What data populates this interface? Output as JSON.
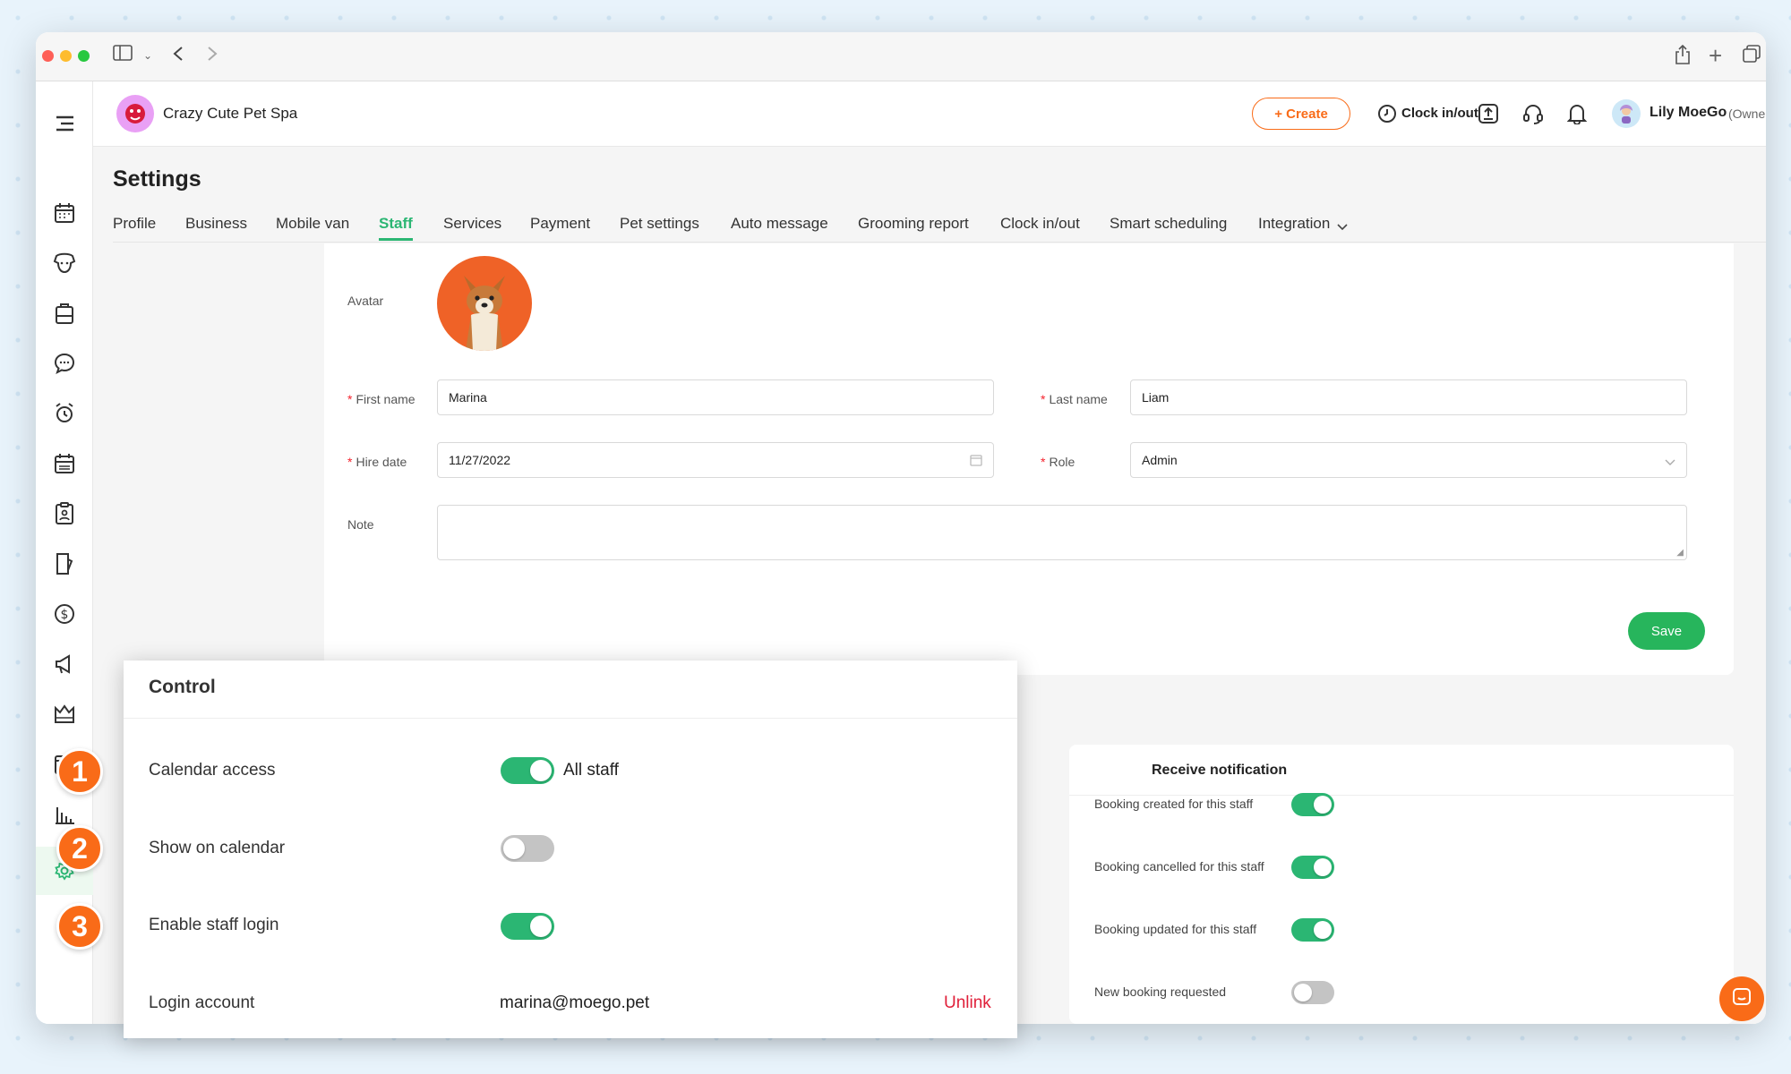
{
  "app": {
    "business_name": "Crazy Cute Pet Spa",
    "create_label": "+ Create",
    "clock_label": "Clock in/out",
    "user_name": "Lily MoeGo",
    "user_role": "(Owner)"
  },
  "page": {
    "title": "Settings"
  },
  "tabs": [
    {
      "label": "Profile"
    },
    {
      "label": "Business"
    },
    {
      "label": "Mobile van"
    },
    {
      "label": "Staff",
      "active": true
    },
    {
      "label": "Services"
    },
    {
      "label": "Payment"
    },
    {
      "label": "Pet settings"
    },
    {
      "label": "Auto message"
    },
    {
      "label": "Grooming report"
    },
    {
      "label": "Clock in/out"
    },
    {
      "label": "Smart scheduling"
    },
    {
      "label": "Integration"
    }
  ],
  "form": {
    "avatar_label": "Avatar",
    "first_name_label": "First name",
    "first_name_value": "Marina",
    "last_name_label": "Last name",
    "last_name_value": "Liam",
    "hire_date_label": "Hire date",
    "hire_date_value": "11/27/2022",
    "role_label": "Role",
    "role_value": "Admin",
    "note_label": "Note",
    "note_value": "",
    "save_label": "Save"
  },
  "control": {
    "title": "Control",
    "items": [
      {
        "number": "1",
        "label": "Calendar access",
        "on": true,
        "value": "All staff"
      },
      {
        "number": "2",
        "label": "Show on calendar",
        "on": false
      },
      {
        "number": "3",
        "label": "Enable staff login",
        "on": true
      }
    ],
    "login_label": "Login account",
    "login_value": "marina@moego.pet",
    "unlink_label": "Unlink"
  },
  "notification": {
    "title": "Receive notification",
    "items": [
      {
        "label": "Booking created for this staff",
        "on": true
      },
      {
        "label": "Booking cancelled for this staff",
        "on": true
      },
      {
        "label": "Booking updated for this staff",
        "on": true
      },
      {
        "label": "New booking requested",
        "on": false
      }
    ]
  },
  "colors": {
    "brand": "#f96b18",
    "accent": "#2bb673",
    "toggle_off": "#c4c4c4",
    "danger": "#f5222d"
  }
}
